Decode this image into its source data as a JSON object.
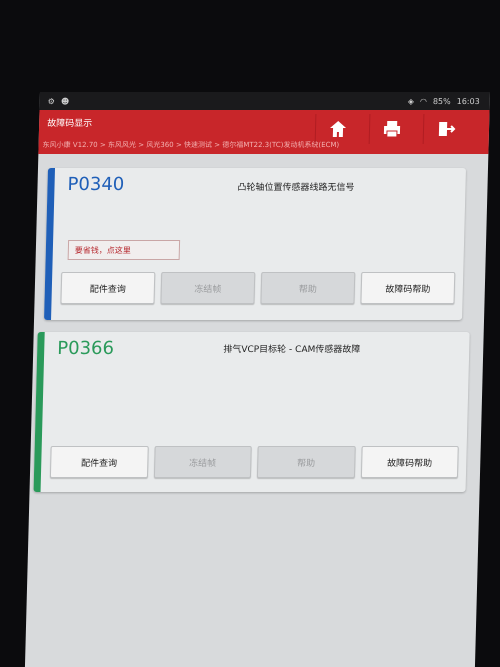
{
  "colors": {
    "accent": "#c8262a",
    "card1_bar": "#1f5fb8",
    "card2_bar": "#2a9a5a",
    "code1": "#1f5fb8",
    "code2": "#2a9a5a"
  },
  "statusbar": {
    "time": "16:03",
    "battery": "85%"
  },
  "header": {
    "title": "故障码显示",
    "breadcrumb": "东风小康 V12.70 > 东风风光 > 风光360 > 快速测试 > 德尔福MT22.3(TC)发动机系统(ECM)",
    "home_icon": "home-icon",
    "print_icon": "printer-icon",
    "exit_icon": "exit-icon"
  },
  "dtcs": [
    {
      "code": "P0340",
      "description": "凸轮轴位置传感器线路无信号",
      "tip": "要省钱，点这里",
      "buttons": {
        "parts": "配件查询",
        "freeze": "冻结帧",
        "help": "帮助",
        "dtc_help": "故障码帮助"
      }
    },
    {
      "code": "P0366",
      "description": "排气VCP目标轮 - CAM传感器故障",
      "buttons": {
        "parts": "配件查询",
        "freeze": "冻结帧",
        "help": "帮助",
        "dtc_help": "故障码帮助"
      }
    }
  ]
}
